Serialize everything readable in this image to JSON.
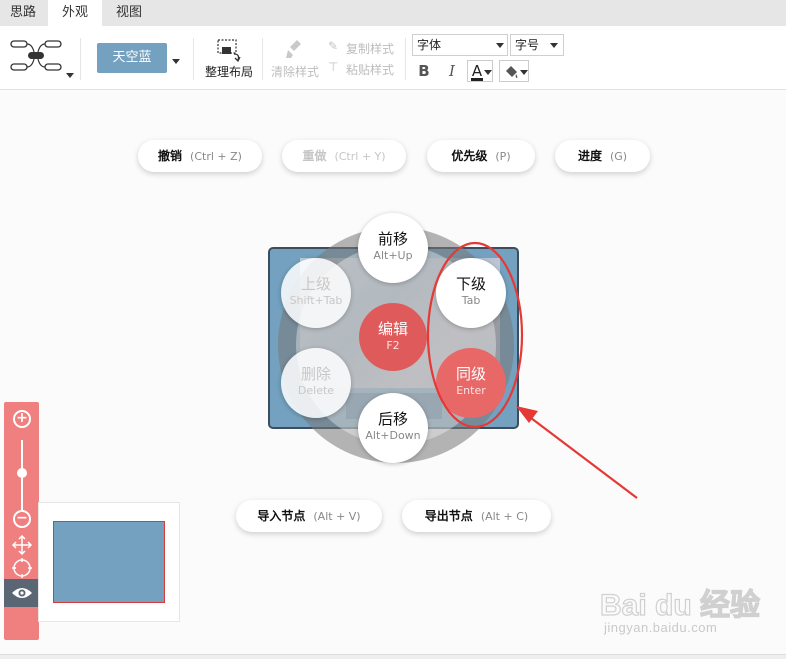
{
  "tabs": [
    {
      "label": "思路"
    },
    {
      "label": "外观"
    },
    {
      "label": "视图"
    }
  ],
  "toolbar": {
    "theme_label": "天空蓝",
    "layout_label": "整理布局",
    "clear_style_label": "清除样式",
    "copy_style_label": "复制样式",
    "paste_style_label": "粘贴样式",
    "font_family_value": "字体",
    "font_size_value": "字号",
    "bold_label": "B",
    "italic_label": "I",
    "font_color_label": "A"
  },
  "hints": [
    {
      "key": "撤销",
      "shortcut": "(Ctrl + Z)"
    },
    {
      "key": "重做",
      "shortcut": "(Ctrl + Y)"
    },
    {
      "key": "优先级",
      "shortcut": "(P)"
    },
    {
      "key": "进度",
      "shortcut": "(G)"
    },
    {
      "key": "导入节点",
      "shortcut": "(Alt + V)"
    },
    {
      "key": "导出节点",
      "shortcut": "(Alt + C)"
    }
  ],
  "radial": {
    "forward": {
      "label": "前移",
      "shortcut": "Alt+Up"
    },
    "parent": {
      "label": "上级",
      "shortcut": "Shift+Tab"
    },
    "child": {
      "label": "下级",
      "shortcut": "Tab"
    },
    "edit": {
      "label": "编辑",
      "shortcut": "F2"
    },
    "delete": {
      "label": "删除",
      "shortcut": "Delete"
    },
    "sibling": {
      "label": "同级",
      "shortcut": "Enter"
    },
    "backward": {
      "label": "后移",
      "shortcut": "Alt+Down"
    }
  },
  "watermark": {
    "brand": "Bai du 经验",
    "url": "jingyan.baidu.com"
  },
  "colors": {
    "accent": "#73a1bf",
    "danger": "#e86767",
    "annotation": "#e53935"
  }
}
